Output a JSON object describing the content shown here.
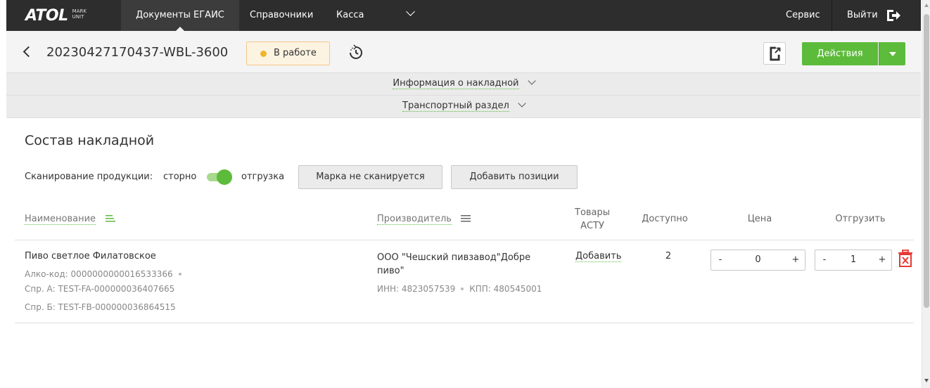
{
  "nav": {
    "logo_text": "ATOL",
    "logo_sub_line1": "MARK",
    "logo_sub_line2": "UNIT",
    "items": [
      {
        "label": "Документы ЕГАИС"
      },
      {
        "label": "Справочники"
      },
      {
        "label": "Касса"
      }
    ],
    "service": "Сервис",
    "logout": "Выйти"
  },
  "header": {
    "doc_id": "20230427170437-WBL-3600",
    "status": "В работе",
    "actions_label": "Действия"
  },
  "sections": {
    "invoice_info": "Информация о накладной",
    "transport": "Транспортный раздел"
  },
  "content": {
    "title": "Состав накладной",
    "scan_label": "Сканирование продукции:",
    "scan_off": "сторно",
    "scan_on": "отгрузка",
    "btn_no_scan": "Марка не сканируется",
    "btn_add_positions": "Добавить позиции"
  },
  "table": {
    "headers": {
      "name": "Наименование",
      "producer": "Производитель",
      "goods_line1": "Товары",
      "goods_line2": "АСТУ",
      "available": "Доступно",
      "price": "Цена",
      "ship": "Отгрузить"
    },
    "rows": [
      {
        "name": "Пиво светлое Филатовское",
        "alco_code": "Алко-код: 0000000000016533366",
        "ref_a": "Спр. А: TEST-FA-000000036407665",
        "ref_b": "Спр. Б: TEST-FB-000000036864515",
        "producer_line1": "ООО \"Чешский пивзавод\"Добре",
        "producer_line2": "пиво\"",
        "inn": "ИНН: 4823057539",
        "kpp": "КПП: 480545001",
        "goods_action": "Добавить",
        "available": "2",
        "price": "0",
        "ship": "1",
        "minus": "-",
        "plus": "+"
      }
    ]
  },
  "colors": {
    "accent": "#5cbb3a",
    "nav_bg": "#2d2d2d",
    "status_dot": "#f0b429",
    "delete": "#e53935"
  }
}
